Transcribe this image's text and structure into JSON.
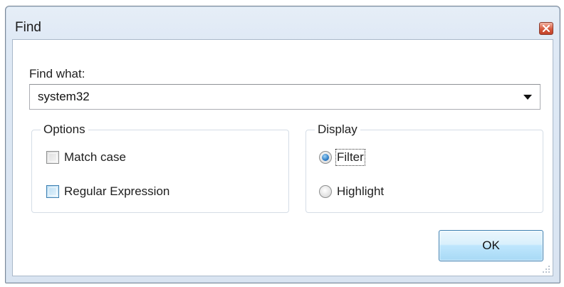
{
  "window": {
    "title": "Find",
    "close_icon": "close-icon"
  },
  "find": {
    "label": "Find what:",
    "value": "system32",
    "dropdown_icon": "chevron-down-icon"
  },
  "options": {
    "legend": "Options",
    "match_case": {
      "label": "Match case",
      "checked": false
    },
    "regex": {
      "label": "Regular Expression",
      "checked": false
    }
  },
  "display": {
    "legend": "Display",
    "filter": {
      "label": "Filter",
      "selected": true
    },
    "highlight": {
      "label": "Highlight",
      "selected": false
    }
  },
  "buttons": {
    "ok": "OK"
  },
  "colors": {
    "accent": "#3c7fb1",
    "close": "#c14128"
  }
}
